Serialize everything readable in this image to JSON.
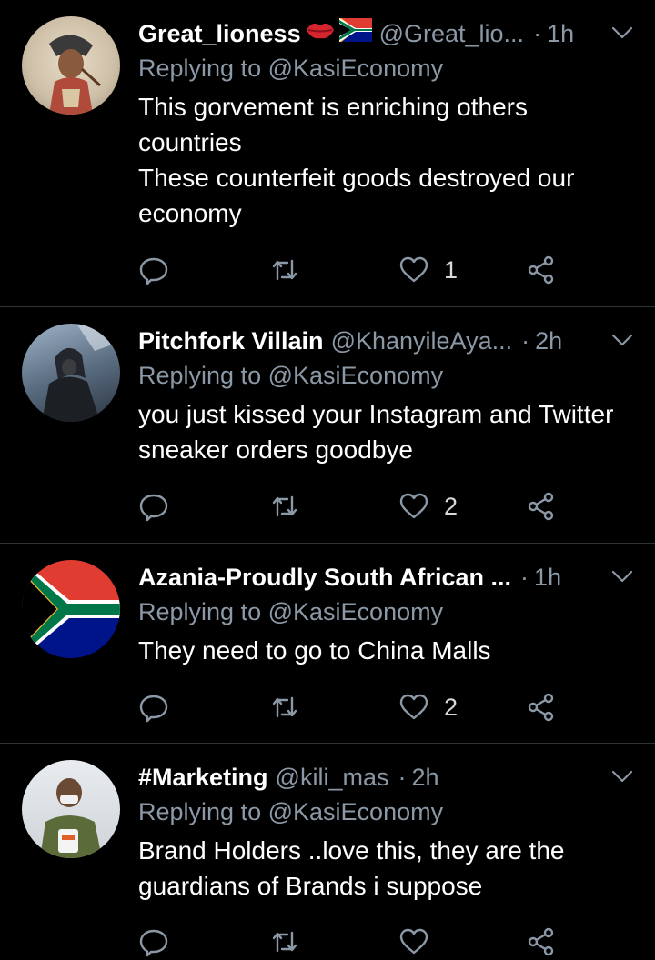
{
  "tweets": [
    {
      "name": "Great_lioness",
      "handle": "@Great_lio...",
      "time": "1h",
      "replying_prefix": "Replying to",
      "replying_to": "@KasiEconomy",
      "text_lines": [
        "This gorvement is enriching others countries",
        "These counterfeit goods destroyed our economy"
      ],
      "like_count": "1"
    },
    {
      "name": "Pitchfork Villain",
      "handle": "@KhanyileAya...",
      "time": "2h",
      "replying_prefix": "Replying to",
      "replying_to": "@KasiEconomy",
      "text_lines": [
        "you just kissed your Instagram and Twitter sneaker orders goodbye"
      ],
      "like_count": "2"
    },
    {
      "name": "Azania-Proudly South African ...",
      "handle": "",
      "time": "1h",
      "replying_prefix": "Replying to",
      "replying_to": "@KasiEconomy",
      "text_lines": [
        "They need to go to China Malls"
      ],
      "like_count": "2"
    },
    {
      "name": "#Marketing",
      "handle": "@kili_mas",
      "time": "2h",
      "replying_prefix": "Replying to",
      "replying_to": "@KasiEconomy",
      "text_lines": [
        "Brand Holders ..love this, they are the guardians of Brands i suppose"
      ],
      "like_count": ""
    }
  ],
  "separator": "·",
  "colors": {
    "background": "#000000",
    "secondary_text": "#8b98a5",
    "divider": "#2f3336",
    "icon": "#8b98a5"
  },
  "icons": {
    "reply": "reply-bubble-icon",
    "retweet": "retweet-icon",
    "like": "heart-icon",
    "share": "share-icon",
    "more": "chevron-down-icon"
  }
}
